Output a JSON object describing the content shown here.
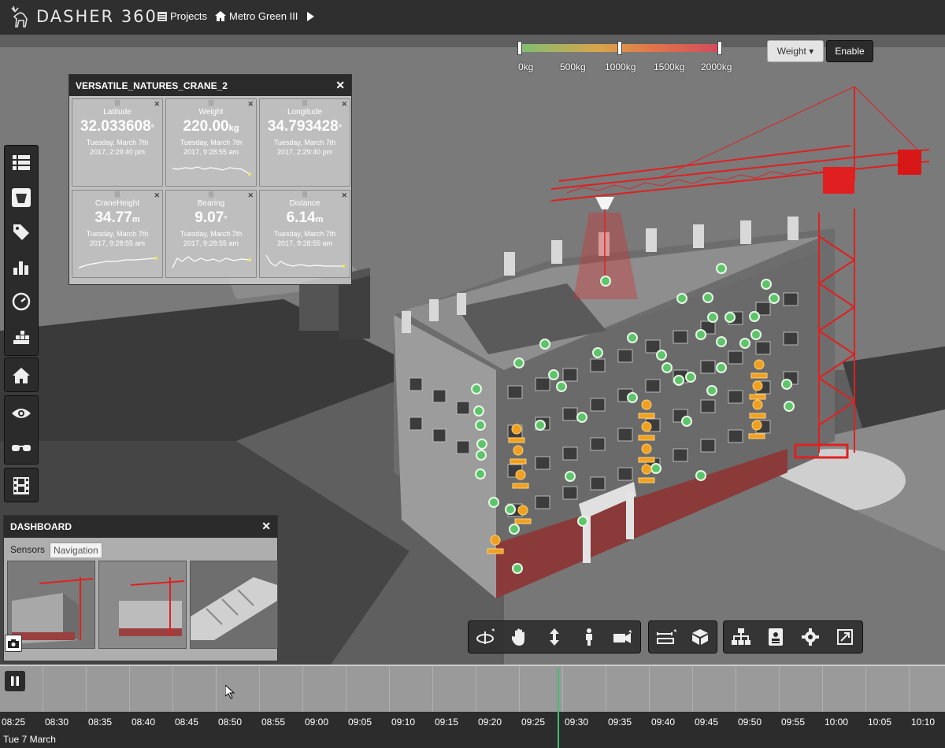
{
  "app": {
    "title": "DASHER 360"
  },
  "breadcrumb": {
    "projects": "Projects",
    "project": "Metro Green III"
  },
  "weight_legend": {
    "ticks": [
      "0kg",
      "500kg",
      "1000kg",
      "1500kg",
      "2000kg"
    ],
    "colors": [
      "#7fbf72",
      "#d9a44a",
      "#e0784a",
      "#d24a5e"
    ]
  },
  "controls": {
    "weight_label": "Weight ▾",
    "enable_label": "Enable"
  },
  "sensor_panel": {
    "title": "VERSATILE_NATURES_CRANE_2",
    "tiles": [
      {
        "label": "Latitude",
        "value": "32.033608",
        "unit": "°",
        "date": "Tuesday, March 7th",
        "time": "2017, 2:29:40 pm"
      },
      {
        "label": "Weight",
        "value": "220.00",
        "unit": "kg",
        "date": "Tuesday, March 7th",
        "time": "2017, 9:28:55 am"
      },
      {
        "label": "Longitude",
        "value": "34.793428",
        "unit": "°",
        "date": "Tuesday, March 7th",
        "time": "2017, 2:29:40 pm"
      },
      {
        "label": "CraneHeight",
        "value": "34.77",
        "unit": "m",
        "date": "Tuesday, March 7th",
        "time": "2017, 9:28:55 am"
      },
      {
        "label": "Bearing",
        "value": "9.07",
        "unit": "°",
        "date": "Tuesday, March 7th",
        "time": "2017, 9:28:55 am"
      },
      {
        "label": "Distance",
        "value": "6.14",
        "unit": "m",
        "date": "Tuesday, March 7th",
        "time": "2017, 9:28:55 am"
      }
    ]
  },
  "dashboard": {
    "title": "DASHBOARD",
    "tabs": [
      "Sensors",
      "Navigation"
    ]
  },
  "timeline": {
    "ticks": [
      "08:25",
      "08:30",
      "08:35",
      "08:40",
      "08:45",
      "08:50",
      "08:55",
      "09:00",
      "09:05",
      "09:10",
      "09:15",
      "09:20",
      "09:25",
      "09:30",
      "09:35",
      "09:40",
      "09:45",
      "09:50",
      "09:55",
      "10:00",
      "10:05",
      "10:10"
    ],
    "date": "Tue 7 March"
  },
  "icons": [
    "deer-logo-icon",
    "list-icon",
    "home-icon",
    "play-icon",
    "table-icon",
    "weight-icon",
    "tag-icon",
    "bar-chart-icon",
    "gauge-icon",
    "stacked-bars-icon",
    "eye-icon",
    "glasses-icon",
    "film-icon",
    "camera-icon",
    "orbit-icon",
    "hand-pan-icon",
    "vertical-move-icon",
    "walk-icon",
    "video-camera-icon",
    "measure-icon",
    "cube-icon",
    "hierarchy-icon",
    "id-card-icon",
    "gear-icon",
    "expand-icon",
    "pause-icon"
  ]
}
